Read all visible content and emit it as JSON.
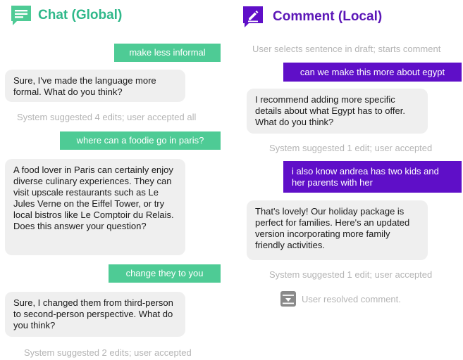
{
  "chat": {
    "title": "Chat (Global)",
    "messages": [
      "make less informal",
      "Sure, I've made the language more formal. What do you think?",
      "System suggested 4 edits; user accepted all",
      "where can a foodie go in paris?",
      "A food lover in Paris can certainly enjoy diverse culinary experiences. They can visit upscale restaurants such as Le Jules Verne on the Eiffel Tower, or try local bistros like Le Comptoir du Relais. Does this answer your question?",
      "change they to you",
      "Sure, I changed them from third-person to second-person perspective. What do you think?",
      "System suggested 2 edits; user accepted"
    ]
  },
  "comment": {
    "title": "Comment (Local)",
    "messages": [
      "User selects sentence in draft; starts comment",
      "can we make this more about egypt",
      "I recommend adding more specific details about what Egypt has to offer. What do you think?",
      "System suggested 1 edit; user accepted",
      "i also know andrea has two kids and her parents with her",
      "That's lovely! Our holiday package is perfect for families. Here's an updated version incorporating more family friendly activities.",
      "System suggested 1 edit; user accepted",
      "User resolved comment."
    ]
  },
  "colors": {
    "chat_accent": "#4ecb95",
    "comment_accent": "#5f0fc8",
    "bot_bubble": "#efefef",
    "system_text": "#b4b4b4"
  },
  "icons": {
    "chat": "chat-bubble-icon",
    "comment": "edit-comment-icon",
    "resolved": "archive-box-icon"
  }
}
